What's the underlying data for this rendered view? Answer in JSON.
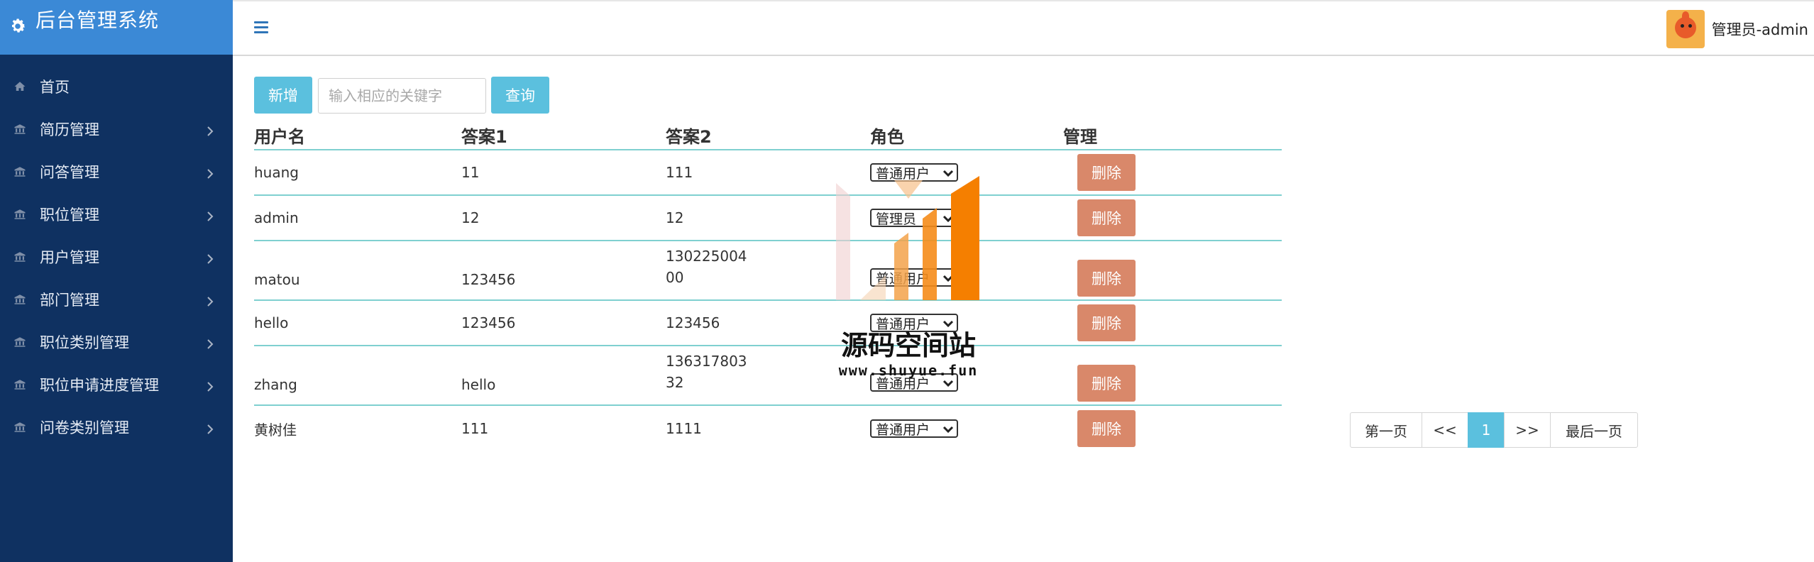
{
  "sidebar": {
    "brand_title": "后台管理系统",
    "items": [
      {
        "label": "首页",
        "icon": "home-icon",
        "expandable": false
      },
      {
        "label": "简历管理",
        "icon": "bank-icon",
        "expandable": true
      },
      {
        "label": "问答管理",
        "icon": "bank-icon",
        "expandable": true
      },
      {
        "label": "职位管理",
        "icon": "bank-icon",
        "expandable": true
      },
      {
        "label": "用户管理",
        "icon": "bank-icon",
        "expandable": true
      },
      {
        "label": "部门管理",
        "icon": "bank-icon",
        "expandable": true
      },
      {
        "label": "职位类别管理",
        "icon": "bank-icon",
        "expandable": true
      },
      {
        "label": "职位申请进度管理",
        "icon": "bank-icon",
        "expandable": true
      },
      {
        "label": "问卷类别管理",
        "icon": "bank-icon",
        "expandable": true
      }
    ]
  },
  "topbar": {
    "menu_icon": "hamburger-icon",
    "user_label": "管理员-admin"
  },
  "toolbar": {
    "add_label": "新增",
    "search_placeholder": "输入相应的关键字",
    "search_value": "",
    "query_label": "查询"
  },
  "table": {
    "headers": [
      "用户名",
      "答案1",
      "答案2",
      "角色",
      "管理"
    ],
    "rows": [
      {
        "username": "huang",
        "answer1": "11",
        "answer2_l1": "111",
        "answer2_l2": "",
        "role": "普通用户",
        "action": "删除"
      },
      {
        "username": "admin",
        "answer1": "12",
        "answer2_l1": "12",
        "answer2_l2": "",
        "role": "管理员",
        "action": "删除"
      },
      {
        "username": "matou",
        "answer1": "123456",
        "answer2_l1": "130225004",
        "answer2_l2": "00",
        "role": "普通用户",
        "action": "删除"
      },
      {
        "username": "hello",
        "answer1": "123456",
        "answer2_l1": "123456",
        "answer2_l2": "",
        "role": "普通用户",
        "action": "删除"
      },
      {
        "username": "zhang",
        "answer1": "hello",
        "answer2_l1": "136317803",
        "answer2_l2": "32",
        "role": "普通用户",
        "action": "删除"
      },
      {
        "username": "黄树佳",
        "answer1": "111",
        "answer2_l1": "1111",
        "answer2_l2": "",
        "role": "普通用户",
        "action": "删除"
      }
    ]
  },
  "pagination": {
    "first": "第一页",
    "prev": "<<",
    "current": "1",
    "next": ">>",
    "last": "最后一页"
  },
  "watermark": {
    "title": "源码空间站",
    "url": "www.shuyue.fun"
  },
  "colors": {
    "sidebar_bg": "#0f3161",
    "brand_bg": "#3b89d6",
    "accent_button": "#5bc0de",
    "delete_button": "#d9886a",
    "row_border": "#7fd0d0"
  }
}
